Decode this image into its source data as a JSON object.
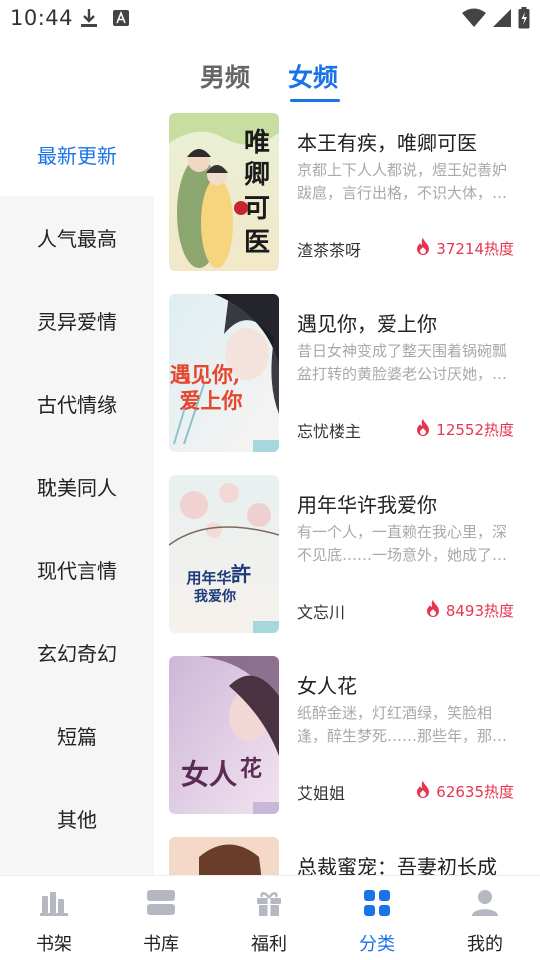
{
  "status": {
    "time": "10:44"
  },
  "gender_tabs": {
    "male": "男频",
    "female": "女频",
    "active": "female"
  },
  "categories": [
    "最新更新",
    "人气最高",
    "灵异爱情",
    "古代情缘",
    "耽美同人",
    "现代言情",
    "玄幻奇幻",
    "短篇",
    "其他"
  ],
  "active_category": "最新更新",
  "books": [
    {
      "title": "本王有疾，唯卿可医",
      "desc": "京都上下人人都说，煜王妃善妒跋扈，言行出格，不识大体，…",
      "author": "渣茶茶呀",
      "heat": "37214热度",
      "cover_title": "唯卿可医"
    },
    {
      "title": "遇见你，爱上你",
      "desc": "昔日女神变成了整天围着锅碗瓢盆打转的黄脸婆老公讨厌她，…",
      "author": "忘忧楼主",
      "heat": "12552热度",
      "cover_title": "遇见你，爱上你"
    },
    {
      "title": "用年华许我爱你",
      "desc": "有一个人，一直赖在我心里，深不见底……一场意外，她成了他…",
      "author": "文忘川",
      "heat": "8493热度",
      "cover_title": "用年华许我爱你"
    },
    {
      "title": "女人花",
      "desc": "纸醉金迷，灯红酒绿，笑脸相逢，醉生梦死……那些年，那一…",
      "author": "艾姐姐",
      "heat": "62635热度",
      "cover_title": "女人花"
    },
    {
      "title": "总裁蜜宠：吾妻初长成",
      "desc": "",
      "author": "",
      "heat": "",
      "cover_title": ""
    }
  ],
  "bottom_nav": [
    {
      "label": "书架",
      "icon": "bookshelf-icon"
    },
    {
      "label": "书库",
      "icon": "library-icon"
    },
    {
      "label": "福利",
      "icon": "gift-icon"
    },
    {
      "label": "分类",
      "icon": "category-icon"
    },
    {
      "label": "我的",
      "icon": "profile-icon"
    }
  ],
  "colors": {
    "accent": "#1a73e8",
    "heat": "#e8354f",
    "sidebar_bg": "#f6f6f6"
  }
}
